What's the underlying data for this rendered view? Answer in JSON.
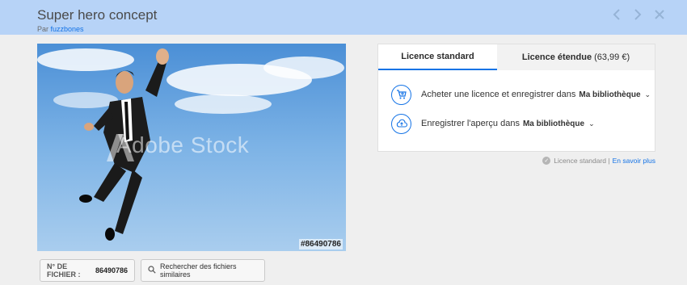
{
  "header": {
    "title": "Super hero concept",
    "by_prefix": "Par",
    "author": "fuzzbones",
    "bg_color": "#b7d3f7"
  },
  "nav_icons": [
    "chevron-left-icon",
    "chevron-right-icon",
    "close-icon"
  ],
  "preview": {
    "watermark": "Adobe Stock",
    "file_tag": "#86490786"
  },
  "file_info": {
    "label": "N° DE FICHIER :",
    "number": "86490786"
  },
  "similar_button": {
    "label": "Rechercher des fichiers similaires"
  },
  "license_tabs": {
    "standard": "Licence standard",
    "extended": "Licence étendue",
    "extended_price": "(63,99 €)"
  },
  "actions": {
    "buy_text": "Acheter une licence et enregistrer dans",
    "buy_library": "Ma bibliothèque",
    "save_text": "Enregistrer l'aperçu dans",
    "save_library": "Ma bibliothèque"
  },
  "license_note": {
    "text": "Licence standard |",
    "link": "En savoir plus"
  },
  "accent_color": "#1473e6"
}
